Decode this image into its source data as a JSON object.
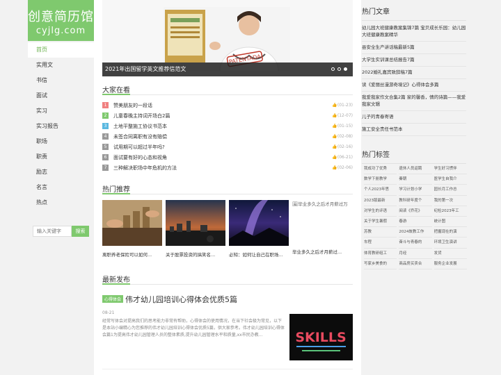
{
  "logo": {
    "title": "创意简历馆",
    "domain": "cyjlg.com"
  },
  "nav": [
    "首页",
    "实用文",
    "书信",
    "面试",
    "实习",
    "实习报告",
    "职场",
    "职责",
    "励志",
    "名言",
    "热点"
  ],
  "search": {
    "placeholder": "输入关键字",
    "button": "搜索"
  },
  "banner": {
    "caption": "2021年出国留学英文推荐信范文",
    "stamp_text": "PATENTADA"
  },
  "hot": {
    "title": "大家在看",
    "items": [
      {
        "rank": "1",
        "title": "赞美朋友的一段话",
        "meta": "(01-23)"
      },
      {
        "rank": "2",
        "title": "儿童春晚主持词开场白2篇",
        "meta": "(12-07)"
      },
      {
        "rank": "3",
        "title": "土地平整施工协议书范本",
        "meta": "(01-15)"
      },
      {
        "rank": "4",
        "title": "未签合同离职有没有赔偿",
        "meta": "(02-08)"
      },
      {
        "rank": "5",
        "title": "试用期可以超过半年吗?",
        "meta": "(02-16)"
      },
      {
        "rank": "6",
        "title": "面试要有好的心态和视角",
        "meta": "(06-21)"
      },
      {
        "rank": "7",
        "title": "三种解决职场中年危机的方法",
        "meta": "(02-06)"
      }
    ],
    "rank_colors": [
      "#f08080",
      "#7fc96e",
      "#5bb8e0",
      "#999999",
      "#999999",
      "#999999",
      "#999999"
    ]
  },
  "recommend": {
    "title": "热门推荐",
    "items": [
      {
        "title": "离职养老保险可以如何..."
      },
      {
        "title": "关于股票投资的搞笑名..."
      },
      {
        "title": "必知：如何让自己在职场..."
      },
      {
        "title": "毕业多久之后才月薪过..."
      }
    ],
    "broken_alt": "毕业多久之后才月薪过万"
  },
  "latest": {
    "title": "最新发布",
    "post": {
      "tag": "心得体会",
      "title": "伟才幼儿园培训心得体会优质5篇",
      "date": "08-21",
      "summary": "经常写体会对提高我们的思考能力非常有帮助，心得体会的使用情况，在当下社会极为常见，以下是本站小编精心为您推荐的伟才幼儿园培训心得体会优质5篇，供大家参考。伟才幼儿园培训心得体会篇1为提高伟才幼儿园管理人员的整体素质,提升幼儿园管理水平和质量,xx市民办教..."
    },
    "thumb_text": "SKILLS"
  },
  "articles": {
    "title": "热门文章",
    "items": [
      "幼儿园大班健康教案集锦7篇 宝贝成长乐园：幼儿园大班健康教案精华",
      "县安全生产讲话稿最新5篇",
      "大学生实训课总结报告7篇",
      "2022婚礼嘉宾致辞稿7篇",
      "读《爱丽丝漫游奇境记》心得体会多篇",
      "我爱我家作文合集2篇 家的馨香，情的诗篇——我爱我家文辑",
      "儿子的青春寄语",
      "施工安全责任书范本"
    ]
  },
  "tags": {
    "title": "热门标签",
    "items": [
      "我成功了优秀",
      "退休人员返聘",
      "学生好习惯伴",
      "数学下册教学",
      "秦朝",
      "医学生自我介",
      "个人2023年思",
      "学习计划小学",
      "园长月工作总",
      "2023版最新",
      "教科研年度个",
      "我的第一次",
      "对学生的评语",
      "阅读《乔花》",
      "纪检2023年工",
      "关于学生暑假",
      "春游",
      "统计图",
      "苏教",
      "2024故教工作",
      "把握现在的演",
      "车程",
      "奋斗与青春的",
      "环境卫生演讲",
      "体育教研组工",
      "月经",
      "发货",
      "写家乡美食的",
      "商品房买卖合",
      "服务企业发展"
    ]
  }
}
